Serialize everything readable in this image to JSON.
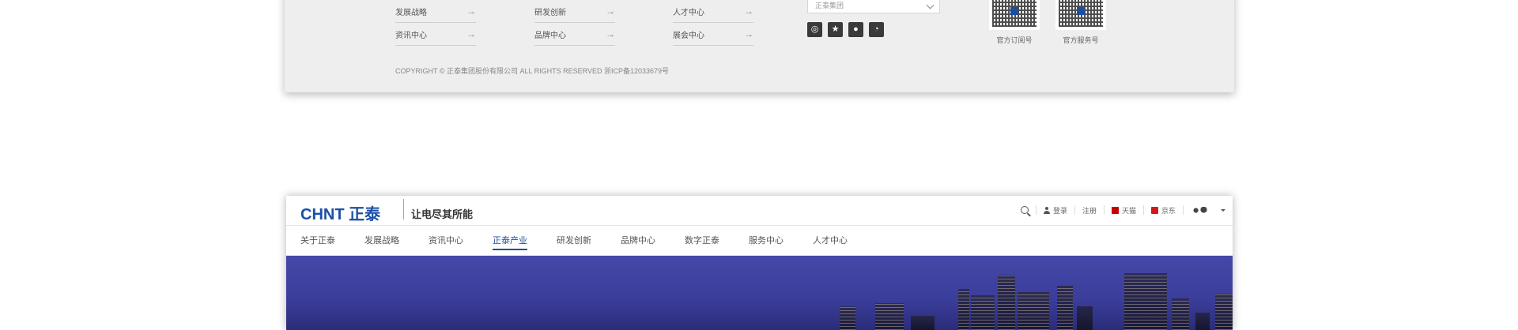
{
  "footer": {
    "columns": [
      [
        {
          "label": "发展战略"
        },
        {
          "label": "资讯中心"
        }
      ],
      [
        {
          "label": "研发创新"
        },
        {
          "label": "品牌中心"
        }
      ],
      [
        {
          "label": "人才中心"
        },
        {
          "label": "展会中心"
        }
      ]
    ],
    "arrow": "→",
    "group_select": {
      "value": "正泰集团"
    },
    "socials": [
      {
        "name": "weibo-icon",
        "glyph": "◎"
      },
      {
        "name": "star-icon",
        "glyph": "★"
      },
      {
        "name": "wechat-icon",
        "glyph": "●"
      },
      {
        "name": "rss-icon",
        "glyph": "◔"
      }
    ],
    "qr_codes": [
      {
        "caption": "官方订阅号"
      },
      {
        "caption": "官方服务号"
      }
    ],
    "copyright": "COPYRIGHT © 正泰集团股份有限公司 ALL RIGHTS RESERVED 浙ICP备12033679号"
  },
  "site": {
    "logo_en": "CHNT",
    "logo_cn": "正泰",
    "slogan": "让电尽其所能",
    "utils": {
      "login": "登录",
      "register": "注册",
      "tmall": "天猫",
      "jd": "京东"
    },
    "nav": [
      {
        "label": "关于正泰"
      },
      {
        "label": "发展战略"
      },
      {
        "label": "资讯中心"
      },
      {
        "label": "正泰产业",
        "active": true
      },
      {
        "label": "研发创新"
      },
      {
        "label": "品牌中心"
      },
      {
        "label": "数字正泰"
      },
      {
        "label": "服务中心"
      },
      {
        "label": "人才中心"
      }
    ],
    "accent": "#1b4fa6"
  }
}
